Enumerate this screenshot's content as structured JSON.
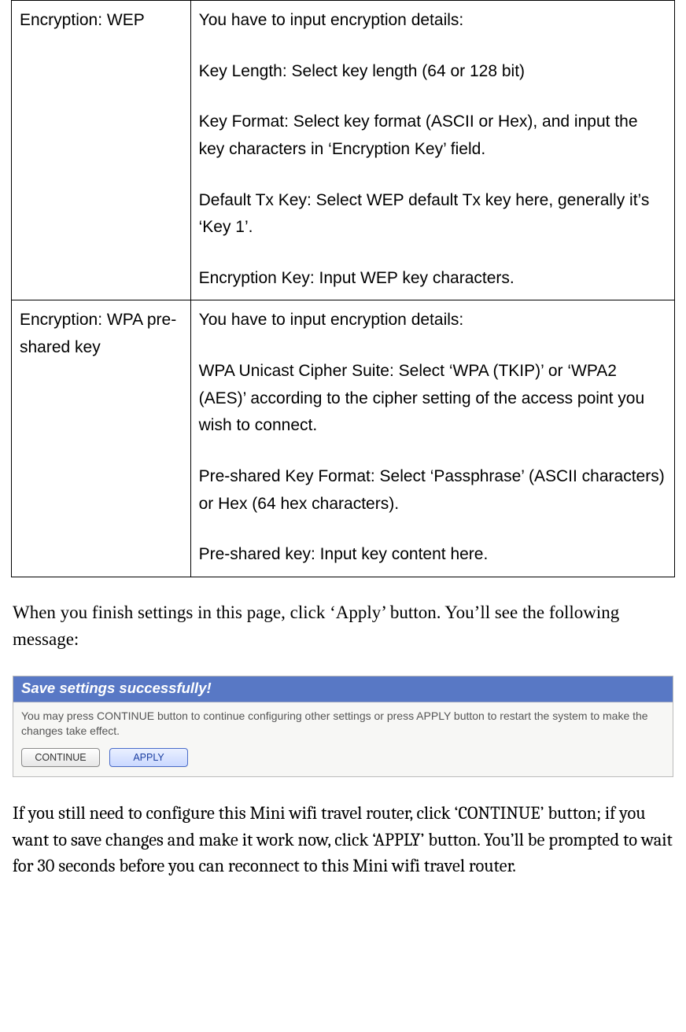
{
  "table": {
    "rows": [
      {
        "left": "Encryption: WEP",
        "right_paragraphs": [
          "You have to input encryption details:",
          "Key Length: Select key length (64 or 128 bit)",
          "Key Format: Select key format (ASCII or Hex), and input the key characters in ‘Encryption Key’ field.",
          "Default Tx Key: Select WEP default Tx key here, generally it’s ‘Key 1’.",
          "Encryption Key: Input WEP key characters."
        ]
      },
      {
        "left": "Encryption: WPA pre-shared key",
        "right_paragraphs": [
          "You have to input encryption details:",
          "WPA Unicast Cipher Suite: Select ‘WPA (TKIP)’ or ‘WPA2 (AES)’ according to the cipher setting of the access point you wish to connect.",
          "Pre-shared Key Format: Select ‘Passphrase’ (ASCII characters) or Hex (64 hex characters).",
          "Pre-shared key: Input key content here."
        ]
      }
    ]
  },
  "paragraph_after_table": "When you finish settings in this page, click ‘Apply’ button. You’ll see the following message:",
  "dialog": {
    "title": "Save settings successfully!",
    "body": "You may press CONTINUE button to continue configuring other settings or press APPLY button to restart the system to make the changes take effect.",
    "buttons": {
      "continue": "CONTINUE",
      "apply": "APPLY"
    }
  },
  "paragraph_end": "If you still need to configure this Mini wifi travel router, click ‘CONTINUE’ button; if you want to save changes and make it work now, click ‘APPLY’ button. You’ll be prompted to wait for 30 seconds before you can reconnect to this Mini wifi travel router."
}
